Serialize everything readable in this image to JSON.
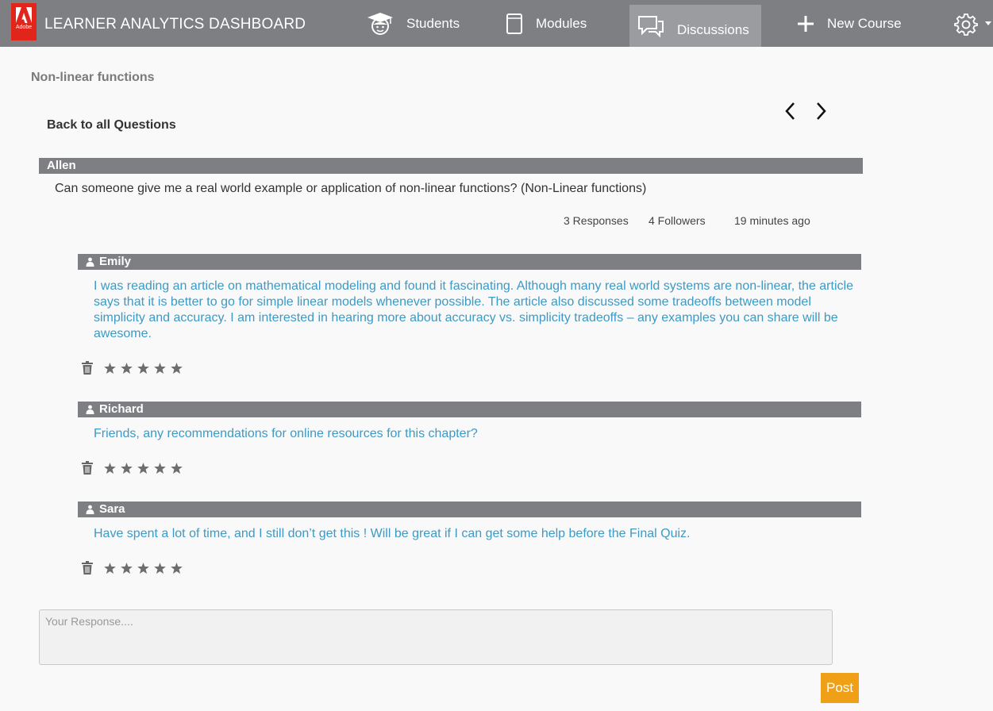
{
  "header": {
    "logo_text": "Adobe",
    "app_title": "LEARNER ANALYTICS DASHBOARD",
    "nav": {
      "students": "Students",
      "modules": "Modules",
      "discussions": "Discussions",
      "new_course": "New Course"
    },
    "icons": {
      "students": "graduate-avatar-icon",
      "modules": "book-icon",
      "discussions": "speech-bubbles-icon",
      "new_course": "plus-icon",
      "settings": "gear-icon"
    },
    "active_tab": "discussions"
  },
  "page": {
    "breadcrumb": "Non-linear functions",
    "back_link": "Back to all Questions"
  },
  "question": {
    "author": "Allen",
    "text": "Can someone give me a real world example or application of non-linear functions? (Non-Linear functions)",
    "responses": "3 Responses",
    "followers": "4 Followers",
    "time": "19 minutes ago"
  },
  "replies": [
    {
      "author": "Emily",
      "text": "I was reading an article on mathematical modeling and found it fascinating. Although many real world systems are non-linear, the article says that it is better to go for simple linear models whenever possible. The article also discussed some tradeoffs between model simplicity and accuracy. I am interested in hearing more about accuracy vs. simplicity tradeoffs – any examples you can share will be awesome."
    },
    {
      "author": "Richard",
      "text": "Friends, any recommendations for online resources for this chapter?"
    },
    {
      "author": "Sara",
      "text": "Have spent a lot of time, and I still don’t get this ! Will be great if I can get some help before the Final Quiz."
    }
  ],
  "response_form": {
    "placeholder": "Your Response....",
    "post_label": "Post"
  },
  "colors": {
    "topbar": "#7d7f83",
    "active_tab": "#9a9ca0",
    "brand_red": "#e1251b",
    "reply_text": "#3c9ac4",
    "post_button": "#f0a017"
  }
}
